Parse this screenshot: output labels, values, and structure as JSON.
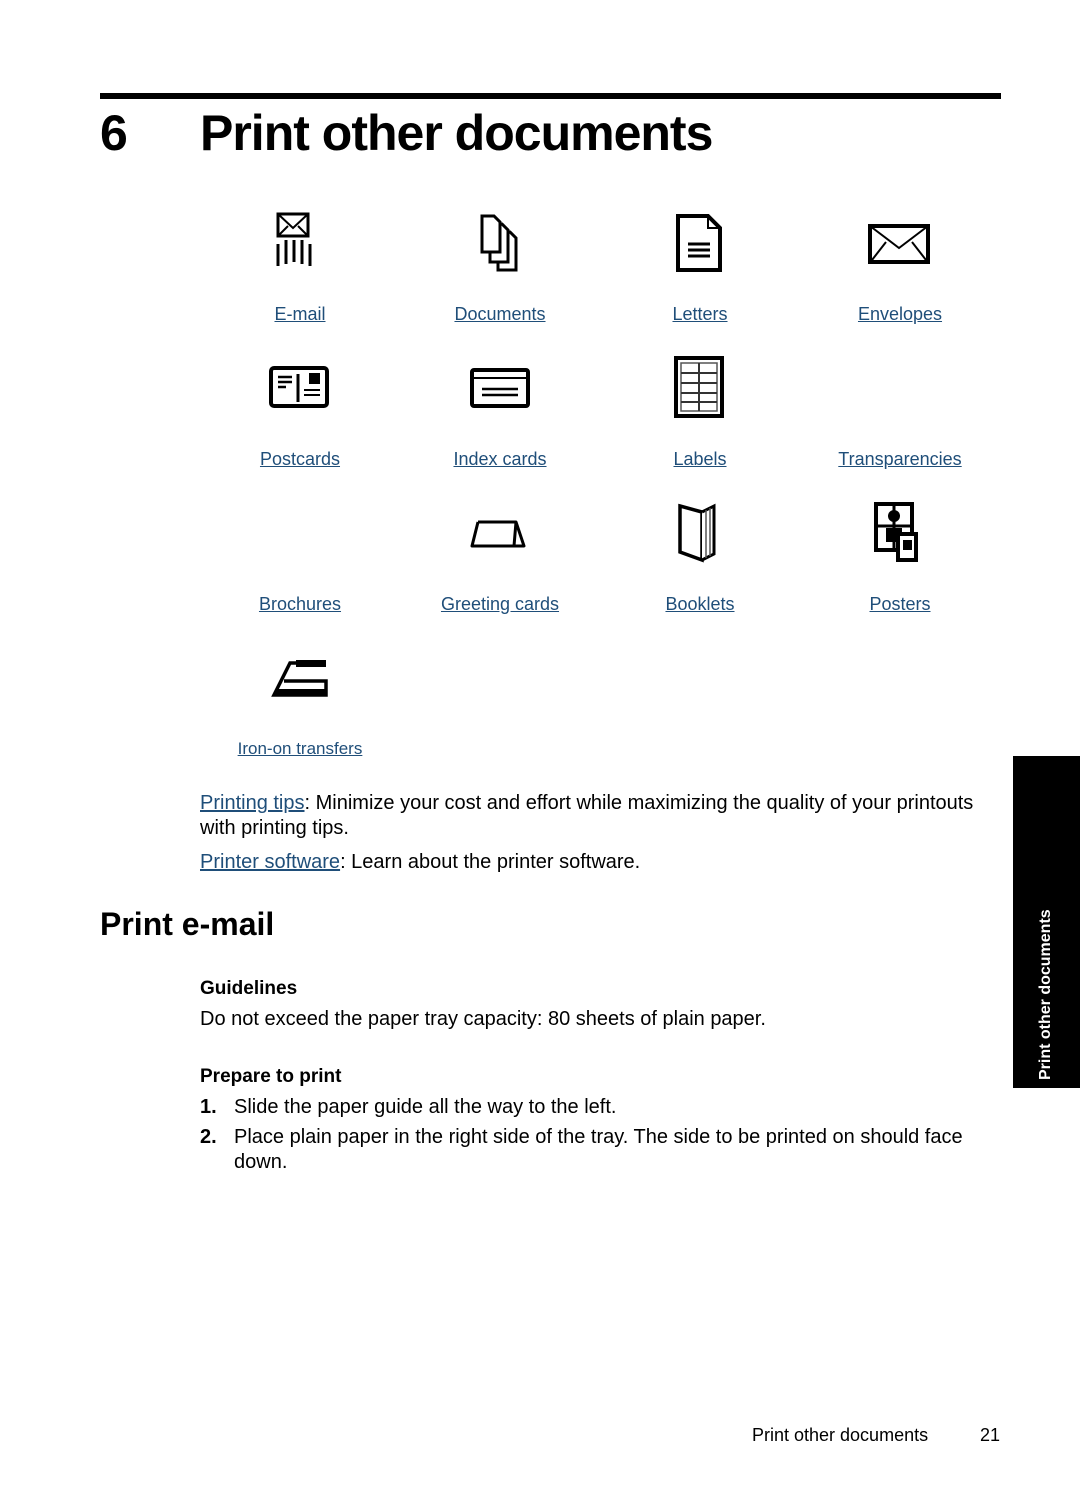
{
  "chapter": {
    "number": "6",
    "title": "Print other documents"
  },
  "grid": [
    {
      "label": "E-mail",
      "icon": "email-icon"
    },
    {
      "label": "Documents",
      "icon": "documents-icon"
    },
    {
      "label": "Letters",
      "icon": "letter-icon"
    },
    {
      "label": "Envelopes",
      "icon": "envelope-icon"
    },
    {
      "label": "Postcards",
      "icon": "postcard-icon"
    },
    {
      "label": "Index cards",
      "icon": "index-card-icon"
    },
    {
      "label": "Labels",
      "icon": "labels-icon"
    },
    {
      "label": "Transparencies",
      "icon": ""
    },
    {
      "label": "Brochures",
      "icon": ""
    },
    {
      "label": "Greeting cards",
      "icon": "greeting-card-icon"
    },
    {
      "label": "Booklets",
      "icon": "booklet-icon"
    },
    {
      "label": "Posters",
      "icon": "poster-icon"
    },
    {
      "label": "Iron-on transfers",
      "icon": "iron-icon"
    }
  ],
  "links": [
    {
      "link": "Printing tips",
      "text": ": Minimize your cost and effort while maximizing the quality of your printouts with printing tips."
    },
    {
      "link": "Printer software",
      "text": ": Learn about the printer software."
    }
  ],
  "section": {
    "title": "Print e-mail",
    "guidelines_heading": "Guidelines",
    "guidelines_text": "Do not exceed the paper tray capacity: 80 sheets of plain paper.",
    "prepare_heading": "Prepare to print",
    "steps": [
      {
        "num": "1.",
        "text": "Slide the paper guide all the way to the left."
      },
      {
        "num": "2.",
        "text": "Place plain paper in the right side of the tray. The side to be printed on should face down."
      }
    ]
  },
  "side_tab": "Print other documents",
  "footer": {
    "title": "Print other documents",
    "page": "21"
  },
  "colors": {
    "link": "#1f4e79"
  }
}
